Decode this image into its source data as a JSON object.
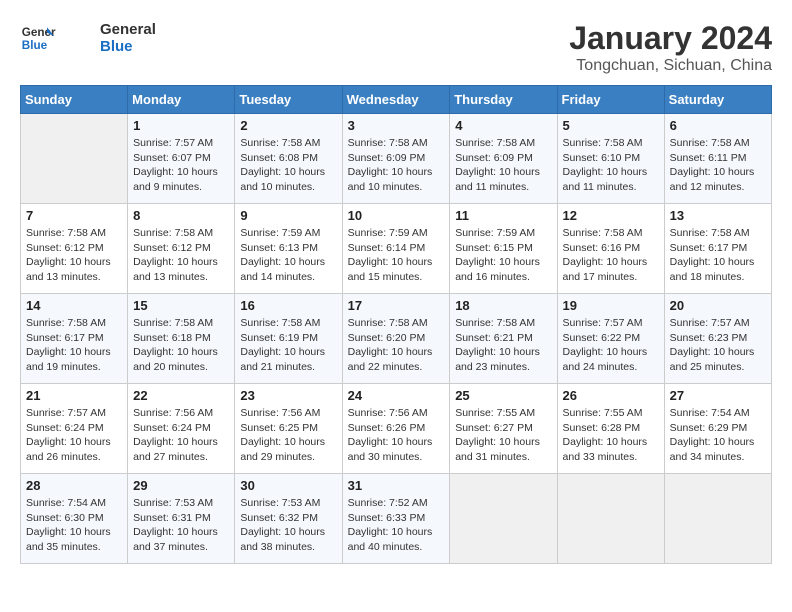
{
  "logo": {
    "line1": "General",
    "line2": "Blue"
  },
  "title": "January 2024",
  "subtitle": "Tongchuan, Sichuan, China",
  "days_of_week": [
    "Sunday",
    "Monday",
    "Tuesday",
    "Wednesday",
    "Thursday",
    "Friday",
    "Saturday"
  ],
  "weeks": [
    [
      {
        "day": "",
        "info": ""
      },
      {
        "day": "1",
        "info": "Sunrise: 7:57 AM\nSunset: 6:07 PM\nDaylight: 10 hours\nand 9 minutes."
      },
      {
        "day": "2",
        "info": "Sunrise: 7:58 AM\nSunset: 6:08 PM\nDaylight: 10 hours\nand 10 minutes."
      },
      {
        "day": "3",
        "info": "Sunrise: 7:58 AM\nSunset: 6:09 PM\nDaylight: 10 hours\nand 10 minutes."
      },
      {
        "day": "4",
        "info": "Sunrise: 7:58 AM\nSunset: 6:09 PM\nDaylight: 10 hours\nand 11 minutes."
      },
      {
        "day": "5",
        "info": "Sunrise: 7:58 AM\nSunset: 6:10 PM\nDaylight: 10 hours\nand 11 minutes."
      },
      {
        "day": "6",
        "info": "Sunrise: 7:58 AM\nSunset: 6:11 PM\nDaylight: 10 hours\nand 12 minutes."
      }
    ],
    [
      {
        "day": "7",
        "info": "Sunrise: 7:58 AM\nSunset: 6:12 PM\nDaylight: 10 hours\nand 13 minutes."
      },
      {
        "day": "8",
        "info": "Sunrise: 7:58 AM\nSunset: 6:12 PM\nDaylight: 10 hours\nand 13 minutes."
      },
      {
        "day": "9",
        "info": "Sunrise: 7:59 AM\nSunset: 6:13 PM\nDaylight: 10 hours\nand 14 minutes."
      },
      {
        "day": "10",
        "info": "Sunrise: 7:59 AM\nSunset: 6:14 PM\nDaylight: 10 hours\nand 15 minutes."
      },
      {
        "day": "11",
        "info": "Sunrise: 7:59 AM\nSunset: 6:15 PM\nDaylight: 10 hours\nand 16 minutes."
      },
      {
        "day": "12",
        "info": "Sunrise: 7:58 AM\nSunset: 6:16 PM\nDaylight: 10 hours\nand 17 minutes."
      },
      {
        "day": "13",
        "info": "Sunrise: 7:58 AM\nSunset: 6:17 PM\nDaylight: 10 hours\nand 18 minutes."
      }
    ],
    [
      {
        "day": "14",
        "info": "Sunrise: 7:58 AM\nSunset: 6:17 PM\nDaylight: 10 hours\nand 19 minutes."
      },
      {
        "day": "15",
        "info": "Sunrise: 7:58 AM\nSunset: 6:18 PM\nDaylight: 10 hours\nand 20 minutes."
      },
      {
        "day": "16",
        "info": "Sunrise: 7:58 AM\nSunset: 6:19 PM\nDaylight: 10 hours\nand 21 minutes."
      },
      {
        "day": "17",
        "info": "Sunrise: 7:58 AM\nSunset: 6:20 PM\nDaylight: 10 hours\nand 22 minutes."
      },
      {
        "day": "18",
        "info": "Sunrise: 7:58 AM\nSunset: 6:21 PM\nDaylight: 10 hours\nand 23 minutes."
      },
      {
        "day": "19",
        "info": "Sunrise: 7:57 AM\nSunset: 6:22 PM\nDaylight: 10 hours\nand 24 minutes."
      },
      {
        "day": "20",
        "info": "Sunrise: 7:57 AM\nSunset: 6:23 PM\nDaylight: 10 hours\nand 25 minutes."
      }
    ],
    [
      {
        "day": "21",
        "info": "Sunrise: 7:57 AM\nSunset: 6:24 PM\nDaylight: 10 hours\nand 26 minutes."
      },
      {
        "day": "22",
        "info": "Sunrise: 7:56 AM\nSunset: 6:24 PM\nDaylight: 10 hours\nand 27 minutes."
      },
      {
        "day": "23",
        "info": "Sunrise: 7:56 AM\nSunset: 6:25 PM\nDaylight: 10 hours\nand 29 minutes."
      },
      {
        "day": "24",
        "info": "Sunrise: 7:56 AM\nSunset: 6:26 PM\nDaylight: 10 hours\nand 30 minutes."
      },
      {
        "day": "25",
        "info": "Sunrise: 7:55 AM\nSunset: 6:27 PM\nDaylight: 10 hours\nand 31 minutes."
      },
      {
        "day": "26",
        "info": "Sunrise: 7:55 AM\nSunset: 6:28 PM\nDaylight: 10 hours\nand 33 minutes."
      },
      {
        "day": "27",
        "info": "Sunrise: 7:54 AM\nSunset: 6:29 PM\nDaylight: 10 hours\nand 34 minutes."
      }
    ],
    [
      {
        "day": "28",
        "info": "Sunrise: 7:54 AM\nSunset: 6:30 PM\nDaylight: 10 hours\nand 35 minutes."
      },
      {
        "day": "29",
        "info": "Sunrise: 7:53 AM\nSunset: 6:31 PM\nDaylight: 10 hours\nand 37 minutes."
      },
      {
        "day": "30",
        "info": "Sunrise: 7:53 AM\nSunset: 6:32 PM\nDaylight: 10 hours\nand 38 minutes."
      },
      {
        "day": "31",
        "info": "Sunrise: 7:52 AM\nSunset: 6:33 PM\nDaylight: 10 hours\nand 40 minutes."
      },
      {
        "day": "",
        "info": ""
      },
      {
        "day": "",
        "info": ""
      },
      {
        "day": "",
        "info": ""
      }
    ]
  ]
}
